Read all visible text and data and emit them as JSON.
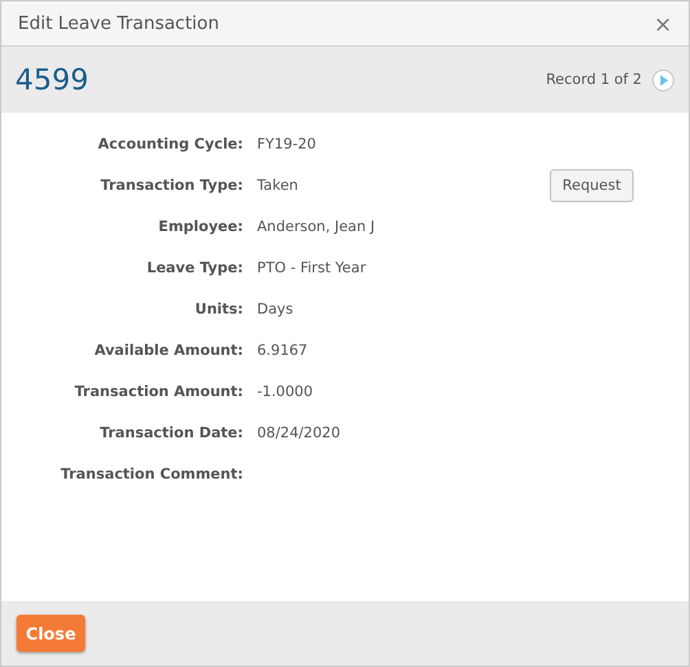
{
  "window": {
    "title": "Edit Leave Transaction",
    "close": "×"
  },
  "header": {
    "id": "4599",
    "record": "Record 1 of 2"
  },
  "fields": [
    {
      "label": "Accounting Cycle:",
      "value": "FY19-20"
    },
    {
      "label": "Transaction Type:",
      "value": "Taken",
      "action": "Request"
    },
    {
      "label": "Employee:",
      "value": "Anderson, Jean J"
    },
    {
      "label": "Leave Type:",
      "value": "PTO - First Year"
    },
    {
      "label": "Units:",
      "value": "Days"
    },
    {
      "label": "Available Amount:",
      "value": "6.9167"
    },
    {
      "label": "Transaction Amount:",
      "value": "-1.0000"
    },
    {
      "label": "Transaction Date:",
      "value": "08/24/2020"
    },
    {
      "label": "Transaction Comment:"
    }
  ],
  "footer": {
    "button": "Close"
  }
}
